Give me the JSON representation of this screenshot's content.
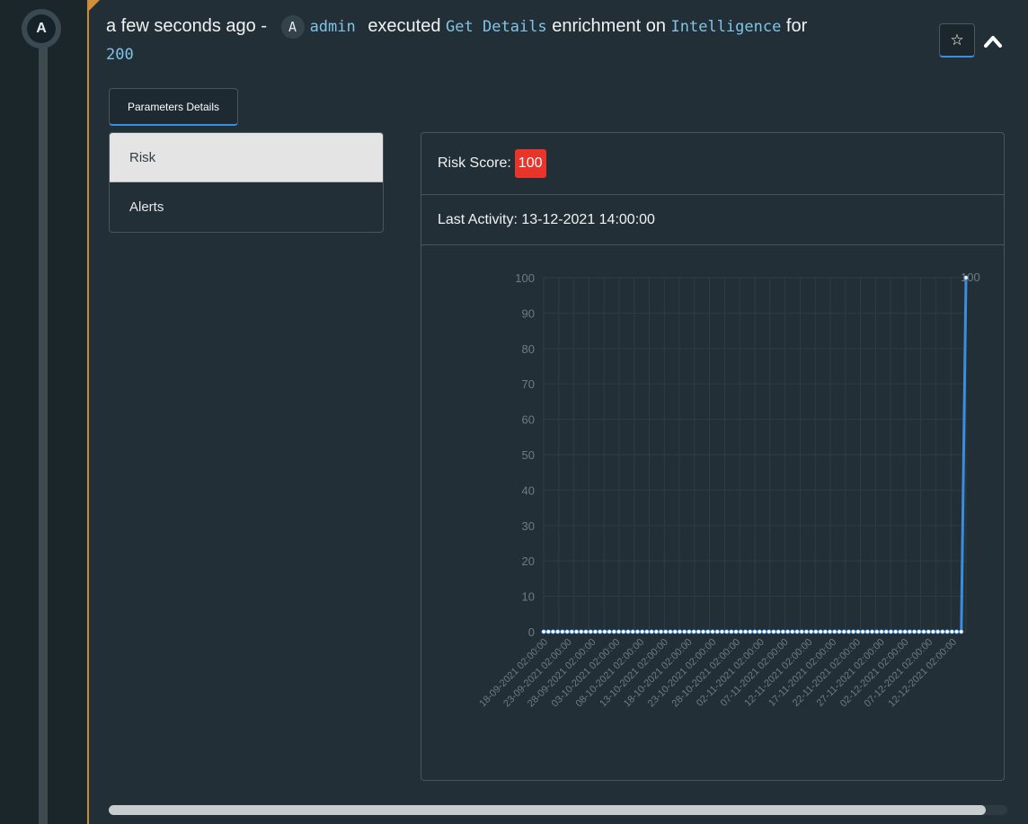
{
  "timeline": {
    "avatar_letter": "A"
  },
  "entry": {
    "time_ago": "a few seconds ago -",
    "actor_avatar": "A",
    "actor": "admin",
    "verb": "executed",
    "action": "Get Details",
    "middle": "enrichment on",
    "target": "Intelligence",
    "preposition": "for",
    "value": "200",
    "star_icon": "star-icon",
    "collapse_icon": "chevron-up-icon"
  },
  "tabs": {
    "parameters_label": "Parameters Details"
  },
  "sidebar": {
    "items": [
      {
        "label": "Risk",
        "active": true
      },
      {
        "label": "Alerts",
        "active": false
      }
    ]
  },
  "details": {
    "risk_label": "Risk Score:",
    "risk_value": "100",
    "activity_label": "Last Activity: 13-12-2021 14:00:00"
  },
  "colors": {
    "line": "#3a8ee0",
    "badge": "#e8342a",
    "accent_border": "#c98a35"
  },
  "chart_data": {
    "type": "line",
    "ylim": [
      0,
      100
    ],
    "y_ticks": [
      0,
      10,
      20,
      30,
      40,
      50,
      60,
      70,
      80,
      90,
      100
    ],
    "grid": true,
    "x_tick_labels": [
      "18-09-2021 02:00:00",
      "23-09-2021 02:00:00",
      "28-09-2021 02:00:00",
      "03-10-2021 02:00:00",
      "08-10-2021 02:00:00",
      "13-10-2021 02:00:00",
      "18-10-2021 02:00:00",
      "23-10-2021 02:00:00",
      "28-10-2021 02:00:00",
      "02-11-2021 02:00:00",
      "07-11-2021 02:00:00",
      "12-11-2021 02:00:00",
      "17-11-2021 02:00:00",
      "22-11-2021 02:00:00",
      "27-11-2021 02:00:00",
      "02-12-2021 02:00:00",
      "07-12-2021 02:00:00",
      "12-12-2021 02:00:00"
    ],
    "x_start": "14-09-2021 02:00:00",
    "x_end": "13-12-2021 14:00:00",
    "series": [
      {
        "values_description": "daily points from 14-09-2021 to 12-12-2021 all 0, final point 13-12-2021 = 100",
        "zero_count": 90,
        "last_value": 100,
        "last_label": "100"
      }
    ]
  }
}
